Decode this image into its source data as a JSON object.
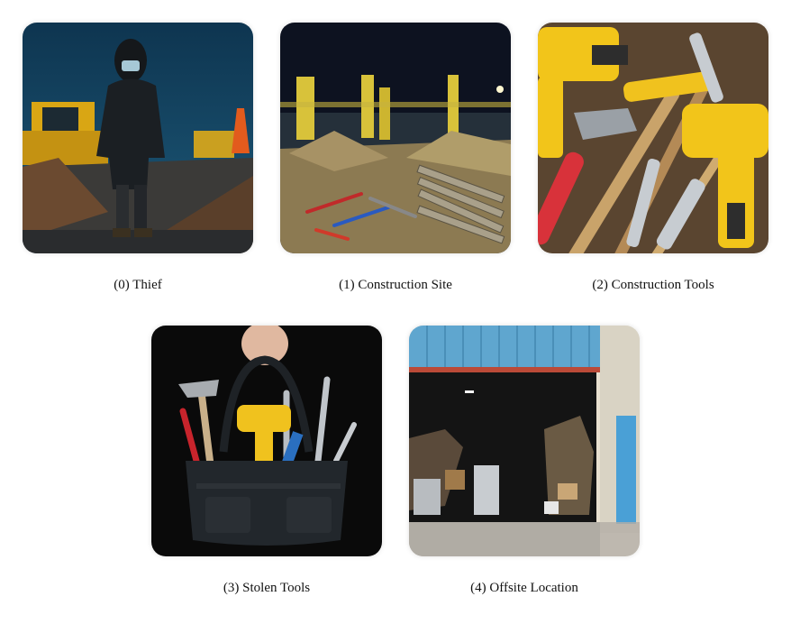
{
  "images": [
    {
      "caption": "(0) Thief"
    },
    {
      "caption": "(1) Construction Site"
    },
    {
      "caption": "(2) Construction Tools"
    },
    {
      "caption": "(3) Stolen Tools"
    },
    {
      "caption": "(4) Offsite Location"
    }
  ]
}
